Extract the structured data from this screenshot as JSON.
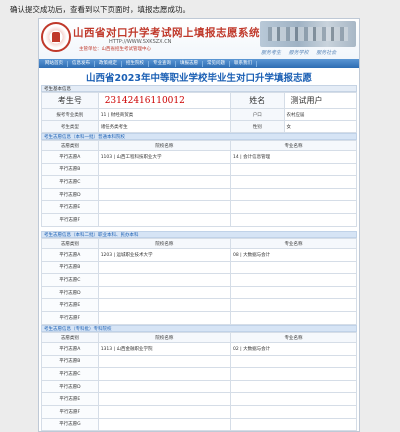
{
  "top_note": "确认提交成功后，查看到以下页面时，填报志愿成功。",
  "banner": {
    "title": "山西省对口升学考试网上填报志愿系统",
    "url": "HTTP://WWW.SXKSZX.CN",
    "host": "主管单位：山西省招生考试管理中心",
    "slogans": [
      "服务考生",
      "服务学校",
      "服务社会"
    ]
  },
  "nav": [
    "网站首页",
    "信息发布",
    "政策规定",
    "招生院校",
    "专业查询",
    "填报志愿",
    "常见问题",
    "联系我们"
  ],
  "main_title": "山西省2023年中等职业学校毕业生对口升学填报志愿",
  "candidate": {
    "section_title": "考生基本信息",
    "exam_no_label": "考生号",
    "exam_no": "23142416110012",
    "name_label": "姓名",
    "name": "测试用户",
    "category_label": "报考专业类别",
    "category": "11 | 财经商贸类",
    "household_label": "户口",
    "household": "农村应届",
    "type_label": "考生类型",
    "type": "诸任务类考生",
    "gender_label": "性别",
    "gender": "女"
  },
  "choices": [
    {
      "title": "考生志愿信息（本科一批）普通本科院校",
      "col_vol": "志愿类别",
      "col_school": "院校名称",
      "col_major": "专业名称",
      "rows": [
        {
          "label": "平行志愿A",
          "school": "1103 | 山西工程科技职业大学",
          "major": "14 | 会计信息管理"
        },
        {
          "label": "平行志愿B",
          "school": "",
          "major": ""
        },
        {
          "label": "平行志愿C",
          "school": "",
          "major": ""
        },
        {
          "label": "平行志愿D",
          "school": "",
          "major": ""
        },
        {
          "label": "平行志愿E",
          "school": "",
          "major": ""
        },
        {
          "label": "平行志愿F",
          "school": "",
          "major": ""
        }
      ]
    },
    {
      "title": "考生志愿信息（本科二批）职业本科、民办本科",
      "col_vol": "志愿类别",
      "col_school": "院校名称",
      "col_major": "专业名称",
      "rows": [
        {
          "label": "平行志愿A",
          "school": "1203 | 运城职业技术大学",
          "major": "08 | 大数据与会计"
        },
        {
          "label": "平行志愿B",
          "school": "",
          "major": ""
        },
        {
          "label": "平行志愿C",
          "school": "",
          "major": ""
        },
        {
          "label": "平行志愿D",
          "school": "",
          "major": ""
        },
        {
          "label": "平行志愿E",
          "school": "",
          "major": ""
        },
        {
          "label": "平行志愿F",
          "school": "",
          "major": ""
        }
      ]
    },
    {
      "title": "考生志愿信息（专科批）专科院校",
      "col_vol": "志愿类别",
      "col_school": "院校名称",
      "col_major": "专业名称",
      "rows": [
        {
          "label": "平行志愿A",
          "school": "1313 | 山西金融职业学院",
          "major": "02 | 大数据与会计"
        },
        {
          "label": "平行志愿B",
          "school": "",
          "major": ""
        },
        {
          "label": "平行志愿C",
          "school": "",
          "major": ""
        },
        {
          "label": "平行志愿D",
          "school": "",
          "major": ""
        },
        {
          "label": "平行志愿E",
          "school": "",
          "major": ""
        },
        {
          "label": "平行志愿F",
          "school": "",
          "major": ""
        },
        {
          "label": "平行志愿G",
          "school": "",
          "major": ""
        }
      ]
    }
  ]
}
